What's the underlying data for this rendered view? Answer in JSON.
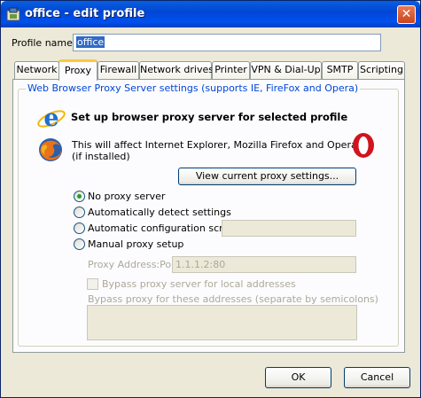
{
  "window": {
    "title": "office - edit profile",
    "close_glyph": "✕"
  },
  "profile": {
    "name_label": "Profile name:",
    "name_value": "office"
  },
  "tabs": [
    {
      "label": "Network",
      "active": false
    },
    {
      "label": "Proxy",
      "active": true
    },
    {
      "label": "Firewall",
      "active": false
    },
    {
      "label": "Network drives",
      "active": false
    },
    {
      "label": "Printer",
      "active": false
    },
    {
      "label": "VPN & Dial-Up",
      "active": false
    },
    {
      "label": "SMTP",
      "active": false
    },
    {
      "label": "Scripting",
      "active": false
    }
  ],
  "proxy": {
    "group_title": "Web Browser Proxy Server settings (supports IE, FireFox and Opera)",
    "heading": "Set up browser proxy server for selected profile",
    "info_line1": "This will affect Internet Explorer, Mozilla Firefox and Opera",
    "info_line2": "(if installed)",
    "view_button": "View current proxy settings...",
    "options": {
      "no_proxy": "No proxy server",
      "auto_detect": "Automatically detect settings",
      "auto_config": "Automatic configuration script:",
      "manual": "Manual proxy setup"
    },
    "selected_option": "no_proxy",
    "auto_config_value": "",
    "address_label": "Proxy Address:Port",
    "address_value": "1.1.1.2:80",
    "bypass_local_label": "Bypass proxy server for local addresses",
    "bypass_local_checked": false,
    "bypass_list_label": "Bypass proxy for these addresses (separate by semicolons)",
    "bypass_list_value": ""
  },
  "footer": {
    "ok_label": "OK",
    "cancel_label": "Cancel"
  },
  "icons": {
    "title": "profile-icon",
    "ie": "internet-explorer-icon",
    "firefox": "firefox-icon",
    "opera": "opera-icon"
  },
  "colors": {
    "titlebar": "#0050ee",
    "accent_tab": "#ffc83c",
    "group_title": "#0046d5",
    "radio_dot": "#21a121"
  }
}
